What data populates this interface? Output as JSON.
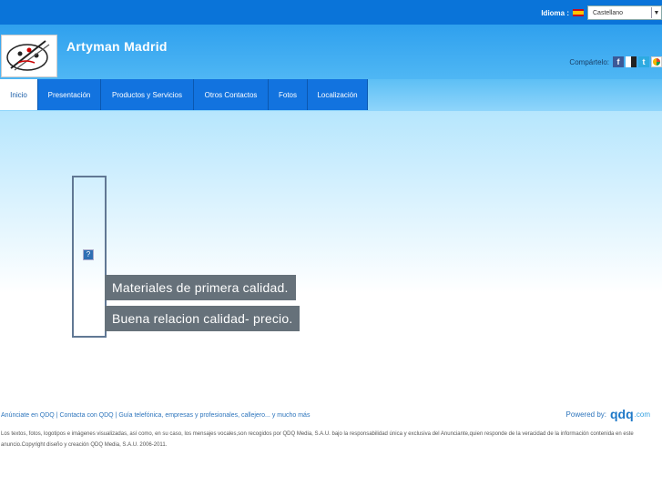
{
  "language": {
    "label": "Idioma :",
    "selected": "Castellano"
  },
  "site": {
    "title": "Artyman Madrid"
  },
  "share": {
    "label": "Compártelo:",
    "icons": [
      "facebook-icon",
      "delicious-icon",
      "twitter-icon",
      "google-buzz-icon"
    ]
  },
  "nav": {
    "tabs": [
      {
        "label": "Inicio",
        "active": true
      },
      {
        "label": "Presentación",
        "active": false
      },
      {
        "label": "Productos y Servicios",
        "active": false
      },
      {
        "label": "Otros Contactos",
        "active": false
      },
      {
        "label": "Fotos",
        "active": false
      },
      {
        "label": "Localización",
        "active": false
      }
    ]
  },
  "slides": {
    "captions": [
      "Materiales de primera calidad.",
      "Buena relacion calidad- precio."
    ],
    "missing_image": "?"
  },
  "footer": {
    "links": [
      "Anúnciate en QDQ",
      "Contacta con QDQ",
      "Guía telefónica, empresas y profesionales, callejero... y mucho más"
    ],
    "separator": " | ",
    "powered_label": "Powered by:",
    "brand": "qdq",
    "brand_suffix": ".com",
    "legal": "Los textos, fotos, logotipos e imágenes visualizadas, así como, en su caso, los mensajes vocales,son recogidos por QDQ Media, S.A.U. bajo la responsabilidad única y exclusiva del Anunciante,quien responde de la veracidad de la información contenida en este anuncio.Copyright diseño y creación QDQ Media, S.A.U. 2006-2011."
  },
  "colors": {
    "topbar": "#0a74d9",
    "tab": "#1273df",
    "caption_bg": "#66717a",
    "link": "#2c74bc"
  }
}
